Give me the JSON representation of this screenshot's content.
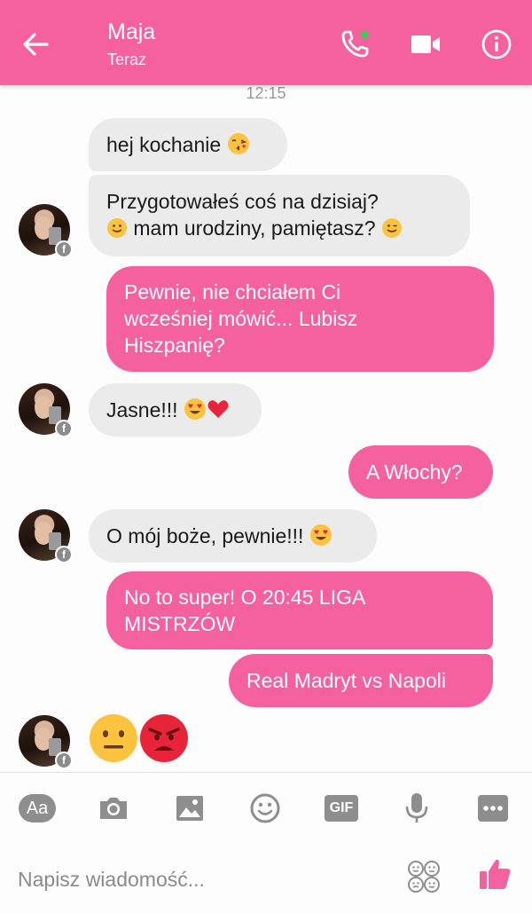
{
  "header": {
    "contact_name": "Maja",
    "status": "Teraz",
    "accent_color": "#f5609f",
    "icons": [
      "back-arrow-icon",
      "phone-call-icon",
      "video-camera-icon",
      "info-icon"
    ]
  },
  "conversation": {
    "timestamp": "12:15",
    "messages": [
      {
        "from": "contact",
        "text": "hej kochanie",
        "emoji": "kiss-face"
      },
      {
        "from": "contact",
        "line1": "Przygotowałeś coś na dzisiaj?",
        "line2": "mam urodziny, pamiętasz?",
        "emoji": [
          "smile",
          "wink"
        ]
      },
      {
        "from": "me",
        "line1": "Pewnie, nie chciałem Ci",
        "line2": "wcześniej mówić... Lubisz",
        "line3": "Hiszpanię?"
      },
      {
        "from": "contact",
        "text": "Jasne!!!",
        "emoji": [
          "heart-eyes",
          "red-heart"
        ]
      },
      {
        "from": "me",
        "text": "A Włochy?"
      },
      {
        "from": "contact",
        "text": "O mój boże, pewnie!!!",
        "emoji": "heart-eyes"
      },
      {
        "from": "me",
        "line1": "No to super! O 20:45 LIGA",
        "line2": "MISTRZÓW"
      },
      {
        "from": "me",
        "text": "Real Madryt vs Napoli"
      },
      {
        "from": "contact",
        "emoji": [
          "neutral-face",
          "angry-face"
        ]
      }
    ]
  },
  "toolbar": {
    "items": [
      "Aa",
      "camera-icon",
      "image-icon",
      "emoji-icon",
      "GIF",
      "microphone-icon",
      "more-icon"
    ]
  },
  "composer": {
    "placeholder": "Napisz wiadomość...",
    "icons": [
      "stickers-icon",
      "thumbs-up-icon"
    ]
  }
}
